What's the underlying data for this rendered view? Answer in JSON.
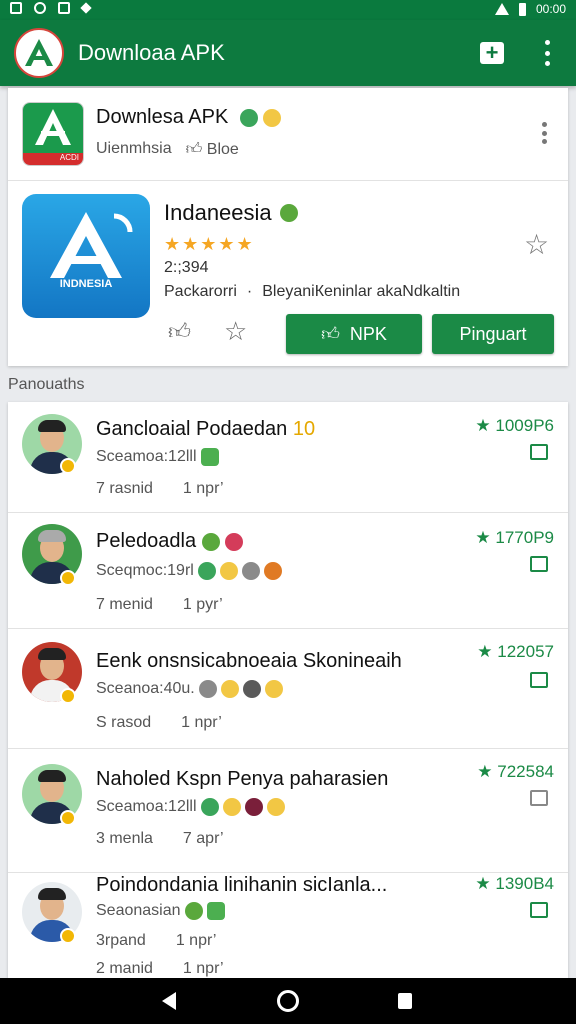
{
  "status_bar": {
    "time": "00:00"
  },
  "app_bar": {
    "title": "Downloaa APK"
  },
  "top_card": {
    "header_name": "Downlesa APK",
    "header_sub_1": "Uienmhsia",
    "header_sub_2": "Bloe",
    "small_icon_band": "ACDI",
    "app_icon_label": "INDNESIA",
    "app_name": "Indaneesia",
    "stars": "★★★★★",
    "rating_count": "2:;394",
    "meta_1": "Packarorri",
    "meta_2": "BleyaniКeninlar akaNdkaltin",
    "btn_1": "NPK",
    "btn_2": "Pinguart"
  },
  "section_label": "Panouaths",
  "list": [
    {
      "title": "Gancloaial Podaedan",
      "title_tag": "10",
      "sub": "Sceamoa:12lll",
      "meta_1": "7 rasnid",
      "meta_2": "1 npr’",
      "score": "★ 1009P6"
    },
    {
      "title": "Peledoadla",
      "sub": "Sceqmoc:19rl",
      "meta_1": "7 menid",
      "meta_2": "1 pyr’",
      "score": "★ 1770P9"
    },
    {
      "title": "Eenk onsnsicabnoeaia Skonineaih",
      "sub": "Sceanoa:40u.",
      "meta_1": "S rasod",
      "meta_2": "1 npr’",
      "score": "★ 122057"
    },
    {
      "title": "Naholed Kspn Penya paharasien",
      "sub": "Sceamoa:12lll",
      "meta_1": "3 menla",
      "meta_2": "7 apr’",
      "score": "★ 722584"
    },
    {
      "title": "Poindondania linihanin sicIanla...",
      "sub": "Seaonasian",
      "meta_1": "3rpand",
      "meta_2": "1 npr’",
      "score": "★ 1390B4"
    },
    {
      "title": "",
      "sub": "",
      "meta_1": "2 manid",
      "meta_2": "1 npr’",
      "score": ""
    }
  ],
  "colors": {
    "primary": "#0d7a3f",
    "accent": "#1b8a46",
    "star": "#f5a623"
  },
  "icons": [
    "logo-icon",
    "add-icon",
    "more-vert-icon",
    "star-outline-icon",
    "thumb-icon",
    "image-icon",
    "back-icon",
    "home-icon",
    "recents-icon"
  ]
}
